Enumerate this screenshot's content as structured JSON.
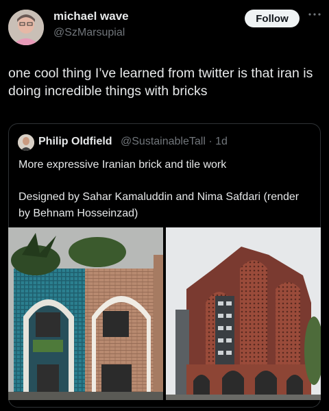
{
  "author": {
    "display_name": "michael wave",
    "handle": "@SzMarsupial",
    "follow_label": "Follow",
    "more_icon": "ellipsis-icon"
  },
  "tweet": {
    "text": "one cool thing I’ve learned from twitter is that iran is doing incredible things with bricks"
  },
  "quote": {
    "display_name": "Philip Oldfield",
    "handle_time": "@SustainableTall · 1d",
    "line1": "More expressive Iranian brick and tile work",
    "line2": "Designed by Sahar Kamaluddin and Nima Safdari (render by Behnam Hosseinzad)"
  },
  "colors": {
    "background": "#000000",
    "text": "#e7e9ea",
    "muted": "#71767b",
    "border": "#2f3336",
    "button_bg": "#eff3f4"
  }
}
